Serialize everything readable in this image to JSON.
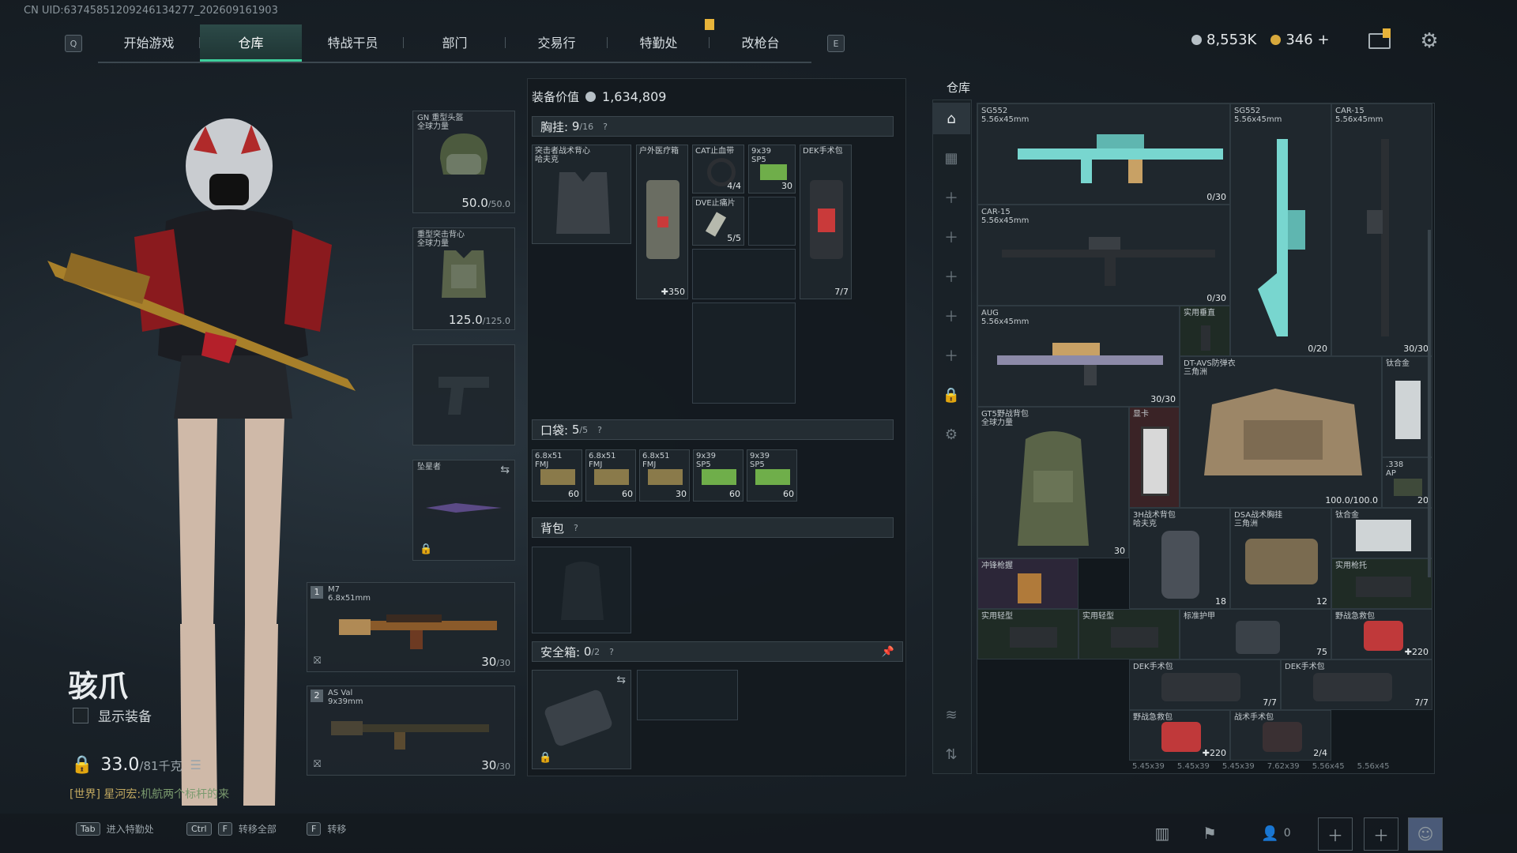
{
  "uid": "CN UID:637458512092461342​77_202609161903",
  "topnav": {
    "left_key": "Q",
    "right_key": "E",
    "tabs": [
      "开始游戏",
      "仓库",
      "特战干员",
      "部门",
      "交易行",
      "特勤处",
      "改枪台"
    ],
    "active_tab": "仓库"
  },
  "currency": {
    "silver": "8,553K",
    "gold": "346",
    "plus": "+"
  },
  "operator": {
    "name": "骇爪",
    "show_equipment_label": "显示装备",
    "weight": "33.0",
    "weight_max": "/81千克"
  },
  "chat": {
    "channel": "[世界]",
    "user": "星河宏:",
    "message": "机航两个标杆的来"
  },
  "slots": {
    "helmet": {
      "name": "GN 重型头盔\n全球力量",
      "value": "50.0",
      "max": "/50.0"
    },
    "armor": {
      "name": "重型突击背心\n全球力量",
      "value": "125.0",
      "max": "/125.0"
    },
    "melee": {
      "name": "坠星者"
    },
    "primary1": {
      "num": "1",
      "name": "M7",
      "ammo": "6.8x51mm",
      "count": "30",
      "max": "/30"
    },
    "primary2": {
      "num": "2",
      "name": "AS Val",
      "ammo": "9x39mm",
      "count": "30",
      "max": "/30"
    }
  },
  "middle": {
    "value_label": "装备价值",
    "value": "1,634,809",
    "chest_rig": {
      "label": "胸挂:",
      "count": "9",
      "max": "/16",
      "help": "?",
      "item": "突击者战术背心\n哈夫克"
    },
    "rig_items": [
      {
        "name": "户外医疗箱",
        "count": "350"
      },
      {
        "name": "CAT止血带",
        "count": "4/4"
      },
      {
        "name": "9x39\nSP5",
        "count": "30"
      },
      {
        "name": "DEK手术包",
        "count": "7/7"
      },
      {
        "name": "DVE止痛片",
        "count": "5/5"
      }
    ],
    "pockets": {
      "label": "口袋:",
      "count": "5",
      "max": "/5",
      "help": "?"
    },
    "pocket_items": [
      {
        "name": "6.8x51\nFMJ",
        "count": "60"
      },
      {
        "name": "6.8x51\nFMJ",
        "count": "60"
      },
      {
        "name": "6.8x51\nFMJ",
        "count": "30"
      },
      {
        "name": "9x39\nSP5",
        "count": "60"
      },
      {
        "name": "9x39\nSP5",
        "count": "60"
      }
    ],
    "backpack": {
      "label": "背包",
      "help": "?"
    },
    "safebox": {
      "label": "安全箱:",
      "count": "0",
      "max": "/2",
      "help": "?"
    }
  },
  "warehouse": {
    "title": "仓库",
    "items": [
      {
        "name": "SG552\n5.56x45mm",
        "count": "0/30"
      },
      {
        "name": "SG552\n5.56x45mm",
        "count": "0/20"
      },
      {
        "name": "CAR-15\n5.56x45mm",
        "count": "30/30"
      },
      {
        "name": "CAR-15\n5.56x45mm",
        "count": "0/30"
      },
      {
        "name": "AUG\n5.56x45mm",
        "count": "30/30"
      },
      {
        "name": "实用垂直",
        "count": ""
      },
      {
        "name": "DT-AVS防弹衣\n三角洲",
        "count": "100.0/100.0"
      },
      {
        "name": "钛合金",
        "count": ""
      },
      {
        "name": "GT5野战背包\n全球力量",
        "count": "30"
      },
      {
        "name": "显卡",
        "count": ""
      },
      {
        "name": ".338\nAP",
        "count": "20"
      },
      {
        "name": "3H战术背包\n哈夫克",
        "count": "18"
      },
      {
        "name": "DSA战术胸挂\n三角洲",
        "count": "12"
      },
      {
        "name": "钛合金",
        "count": ""
      },
      {
        "name": "冲锋枪握",
        "count": ""
      },
      {
        "name": "实用枪托",
        "count": ""
      },
      {
        "name": "实用轻型",
        "count": ""
      },
      {
        "name": "实用轻型",
        "count": ""
      },
      {
        "name": "标准护甲",
        "count": "75"
      },
      {
        "name": "野战急救包",
        "count": "220"
      },
      {
        "name": "DEK手术包",
        "count": "7/7"
      },
      {
        "name": "DEK手术包",
        "count": "7/7"
      },
      {
        "name": "野战急救包",
        "count": "220"
      },
      {
        "name": "战术手术包",
        "count": "2/4"
      }
    ],
    "bottom_row": [
      "5.45x39",
      "5.45x39",
      "5.45x39",
      "7.62x39",
      "5.56x45",
      "5.56x45"
    ]
  },
  "bottom": {
    "hints": [
      {
        "key": "Tab",
        "label": "进入特勤处"
      },
      {
        "key": "Ctrl",
        "key2": "F",
        "label": "转移全部"
      },
      {
        "key": "F",
        "label": "转移"
      }
    ],
    "friends": "0"
  },
  "colors": {
    "accent": "#3ecf9c",
    "tab_bg": "#2c4a48",
    "weapon_teal": "#78d6cf",
    "warn": "#e8b43a"
  }
}
